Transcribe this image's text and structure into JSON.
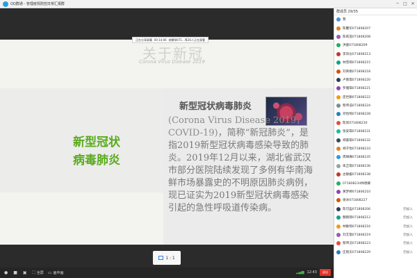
{
  "window": {
    "title": "QQ群通 - 管理疫情防控日常汇报群",
    "controls": [
      "─",
      "□",
      "✕"
    ]
  },
  "infobar": {
    "left": "正在分享屏幕",
    "middle": "00:14:06",
    "right": "林慧琴071...等26人正在观看"
  },
  "slide": {
    "title": "关于新冠",
    "subtitle": "Corona Virus Disease 2019",
    "green_title_line1": "新型冠状",
    "green_title_line2": "病毒肺炎",
    "heading": "新型冠状病毒肺炎",
    "body_en": "(Corona Virus Disease 2019，COVID-19)",
    "body_cn": "，简称“新冠肺炎”，是指2019新型冠状病毒感染导致的肺炎。2019年12月以来，湖北省武汉市部分医院陆续发现了多例有华南海鲜市场暴露史的不明原因肺炎病例，现已证实为2019新型冠状病毒感染引起的急性呼吸道传染病。"
  },
  "ratio": {
    "label": "1 : 1"
  },
  "toolbar": {
    "items": [
      "",
      "",
      "",
      "全屏",
      "画中画"
    ],
    "time": "12:43",
    "exit": "退出"
  },
  "panel": {
    "header": "群成员 29/35",
    "members": [
      {
        "name": "我",
        "action": "",
        "color": "#4a90e2"
      },
      {
        "name": "陈馨华071808207",
        "action": "",
        "color": "#e67e22"
      },
      {
        "name": "陈莉莲071808208",
        "action": "",
        "color": "#9b59b6"
      },
      {
        "name": "洪嘉071808209",
        "action": "",
        "color": "#27ae60"
      },
      {
        "name": "李凤仪071808213",
        "action": "",
        "color": "#c0392b"
      },
      {
        "name": "林雪琦071808215",
        "action": "",
        "color": "#16a085"
      },
      {
        "name": "刘英格071808218",
        "action": "",
        "color": "#d35400"
      },
      {
        "name": "卢春琪071808220",
        "action": "",
        "color": "#2c3e50"
      },
      {
        "name": "罗雅琪071808221",
        "action": "",
        "color": "#8e44ad"
      },
      {
        "name": "庞世颖071808222",
        "action": "",
        "color": "#f39c12"
      },
      {
        "name": "蔡伟浩071808224",
        "action": "",
        "color": "#7f8c8d"
      },
      {
        "name": "邓怡琦071808228",
        "action": "",
        "color": "#2980b9"
      },
      {
        "name": "陈欣071808230",
        "action": "",
        "color": "#e74c3c"
      },
      {
        "name": "张安琪071808231",
        "action": "",
        "color": "#1abc9c"
      },
      {
        "name": "郑嘉琪071808232",
        "action": "",
        "color": "#34495e"
      },
      {
        "name": "郑子怡071808233",
        "action": "",
        "color": "#e67e22"
      },
      {
        "name": "周琳琳071808235",
        "action": "",
        "color": "#3498db"
      },
      {
        "name": "朱芷琪071808236",
        "action": "",
        "color": "#95a5a6"
      },
      {
        "name": "古静媛071808238",
        "action": "",
        "color": "#c0392b"
      },
      {
        "name": "071808234林德卿",
        "action": "",
        "color": "#27ae60"
      },
      {
        "name": "黄梦婷071806210",
        "action": "",
        "color": "#8e44ad"
      },
      {
        "name": "谢冰071808227",
        "action": "",
        "color": "#d35400"
      },
      {
        "name": "陈可盈071808206",
        "action": "仍加入",
        "color": "#2c3e50"
      },
      {
        "name": "魏雨菲071808212",
        "action": "仍加入",
        "color": "#16a085"
      },
      {
        "name": "林敏琦071808216",
        "action": "仍加入",
        "color": "#f39c12"
      },
      {
        "name": "刘艾琪071808219",
        "action": "仍加入",
        "color": "#9b59b6"
      },
      {
        "name": "蔡伟沅071808223",
        "action": "仍加入",
        "color": "#e74c3c"
      },
      {
        "name": "庄晓天071808229",
        "action": "仍加入",
        "color": "#2980b9"
      }
    ]
  }
}
